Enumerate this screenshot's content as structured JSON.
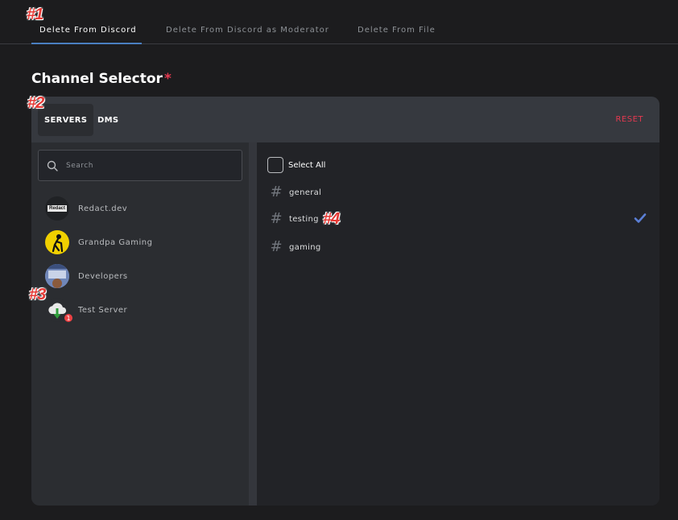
{
  "markers": [
    "#1",
    "#2",
    "#3",
    "#4"
  ],
  "tabs": [
    {
      "label": "Delete From Discord",
      "active": true
    },
    {
      "label": "Delete From Discord as Moderator",
      "active": false
    },
    {
      "label": "Delete From File",
      "active": false
    }
  ],
  "section": {
    "title": "Channel Selector",
    "required_mark": "*"
  },
  "card": {
    "tabs": [
      {
        "label": "SERVERS",
        "active": true
      },
      {
        "label": "DMS",
        "active": false
      }
    ],
    "reset_label": "RESET"
  },
  "search": {
    "placeholder": "Search",
    "value": ""
  },
  "servers": [
    {
      "name": "Redact.dev",
      "avatar_text": "Redact"
    },
    {
      "name": "Grandpa Gaming"
    },
    {
      "name": "Developers"
    },
    {
      "name": "Test Server",
      "badge": "1"
    }
  ],
  "channels": {
    "select_all_label": "Select All",
    "hash_glyph": "#",
    "items": [
      {
        "name": "general",
        "selected": false
      },
      {
        "name": "testing",
        "selected": true
      },
      {
        "name": "gaming",
        "selected": false
      }
    ]
  },
  "colors": {
    "accent": "#4a7fc1",
    "danger": "#e53950",
    "check": "#5b7fd6",
    "background": "#1c1c1e"
  }
}
